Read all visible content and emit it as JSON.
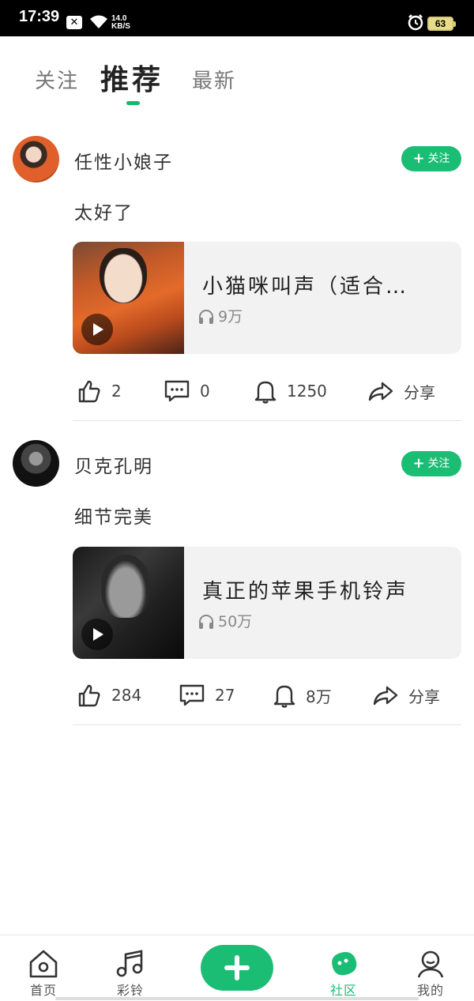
{
  "status_bar": {
    "time": "17:39",
    "notification_icon": "close-box-icon",
    "speed_value": "14.0",
    "speed_unit": "KB/S",
    "battery": "63"
  },
  "tabs": {
    "follow": "关注",
    "recommended": "推荐",
    "latest": "最新",
    "active": "推荐"
  },
  "posts": [
    {
      "username": "任性小娘子",
      "follow_label": "关注",
      "text": "太好了",
      "media": {
        "title": "小猫咪叫声（适合…",
        "plays": "9万"
      },
      "likes": "2",
      "comments": "0",
      "ringtone_count": "1250",
      "share_label": "分享"
    },
    {
      "username": "贝克孔明",
      "follow_label": "关注",
      "text": "细节完美",
      "media": {
        "title": "真正的苹果手机铃声",
        "plays": "50万"
      },
      "likes": "284",
      "comments": "27",
      "ringtone_count": "8万",
      "share_label": "分享"
    }
  ],
  "bottom_nav": {
    "home": "首页",
    "ringtones": "彩铃",
    "community": "社区",
    "mine": "我的",
    "active": "社区"
  },
  "colors": {
    "accent": "#1bbd74",
    "status_bar_bg": "#000000"
  }
}
